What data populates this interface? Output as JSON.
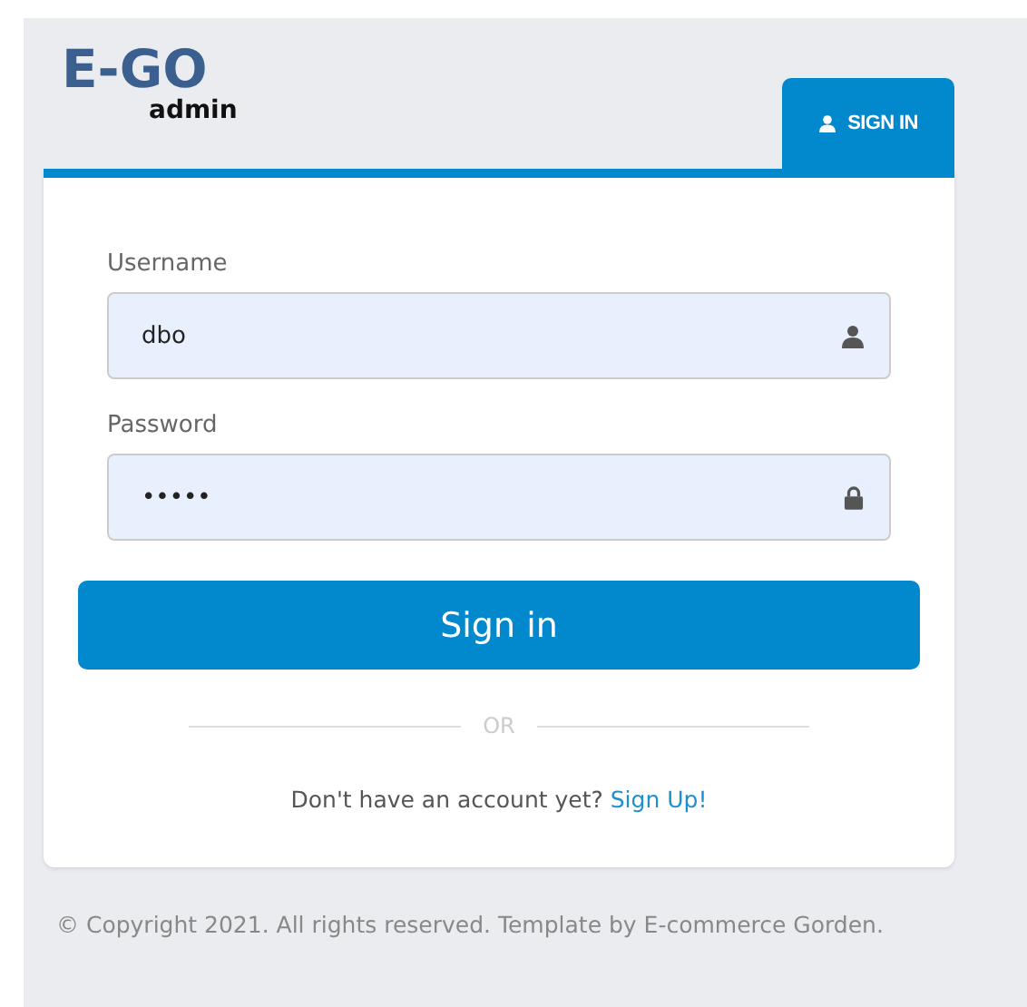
{
  "logo": {
    "title": "E-GO",
    "subtitle": "admin"
  },
  "tabs": [
    {
      "label": "SIGN IN",
      "selected": true
    }
  ],
  "fields": [
    {
      "label": "Username",
      "value": "dbo",
      "kind": "user"
    },
    {
      "label": "Password",
      "value": "•••••",
      "kind": "lock"
    }
  ],
  "submit": "Sign in",
  "divider": "OR",
  "signup": {
    "text": "Don't have an account yet?",
    "link": "Sign Up!"
  },
  "footer": "© Copyright 2021. All rights reserved. Template by E-commerce Gorden."
}
